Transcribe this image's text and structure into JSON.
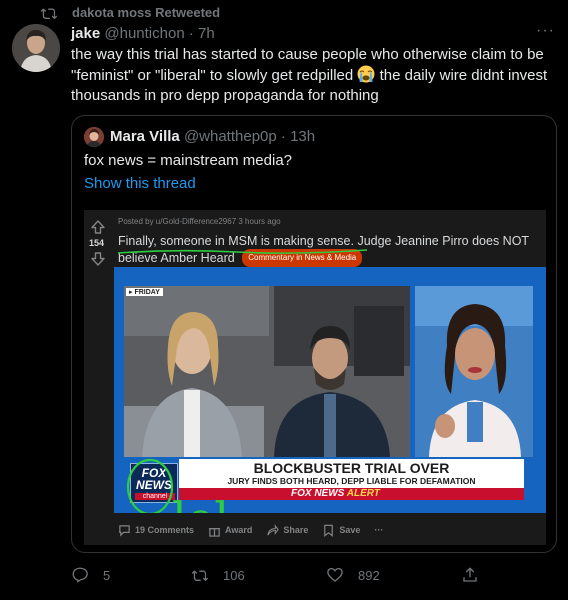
{
  "retweet": {
    "label": "dakota moss Retweeted",
    "icon": "retweet-icon"
  },
  "tweet": {
    "author_name": "jake",
    "author_handle": "@huntichon",
    "separator": "·",
    "time": "7h",
    "text_part1": "the way this trial has started to cause people who otherwise claim to be \"feminist\" or \"liberal\" to slowly get redpilled ",
    "emoji": "loudly-crying-face",
    "text_part2": " the daily wire didnt invest thousands in pro depp propaganda for nothing",
    "more_icon": "more-icon",
    "more_label": "···"
  },
  "quote": {
    "author_name": "Mara Villa",
    "author_handle": "@whatthep0p",
    "separator": "·",
    "time": "13h",
    "text": "fox news = mainstream media?",
    "show_thread": "Show this thread"
  },
  "reddit_post": {
    "votes": "154",
    "posted_by": "Posted by u/Gold-Difference2967 3 hours ago",
    "title": "Finally, someone in MSM is making sense. Judge Jeanine Pirro does NOT believe Amber Heard",
    "flair": "Commentary in News & Media",
    "image": {
      "corner_label": "FRIDAY",
      "headline": "BLOCKBUSTER TRIAL OVER",
      "subheadline": "JURY FINDS BOTH HEARD, DEPP LIABLE FOR DEFAMATION",
      "alert_brand": "FOX NEWS",
      "alert_word": "ALERT",
      "logo_line1": "FOX",
      "logo_line2": "NEWS",
      "logo_line3": "channel",
      "handwritten": "lol"
    },
    "actions": {
      "comments": "19 Comments",
      "award": "Award",
      "share": "Share",
      "save": "Save",
      "more": "···"
    }
  },
  "actions": {
    "replies": "5",
    "retweets": "106",
    "likes": "892",
    "share_icon": "share-icon"
  },
  "colors": {
    "background": "#000000",
    "text": "#e7e9ea",
    "muted": "#71767b",
    "link": "#1d9bf0",
    "border": "#2f3336",
    "reddit_bg": "#1a1a1b",
    "flair": "#cc3700",
    "highlight_green": "#2ecc40"
  }
}
